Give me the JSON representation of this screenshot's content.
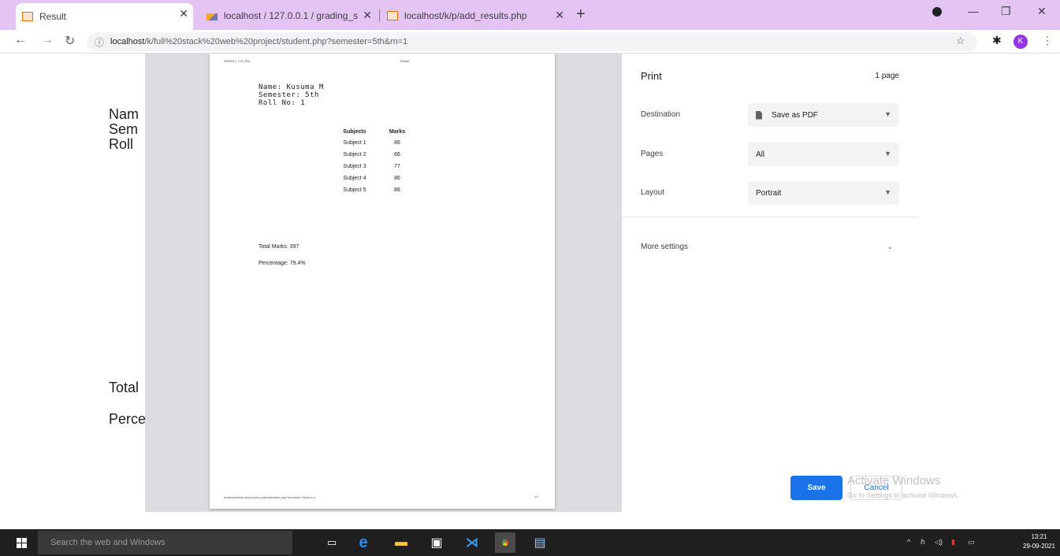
{
  "browser": {
    "tabs": [
      {
        "title": "Result"
      },
      {
        "title": "localhost / 127.0.0.1 / grading_s"
      },
      {
        "title": "localhost/k/p/add_results.php"
      }
    ],
    "address_host": "localhost",
    "address_path": "/k/full%20stack%20web%20project/student.php?semester=5th&rn=1"
  },
  "background_page": {
    "lines": [
      "Nam",
      "Sem",
      "Roll"
    ],
    "total": "Total",
    "percentage": "Perce"
  },
  "print_preview": {
    "header_date": "29/09/21, 1:21 PM",
    "header_title": "Result",
    "name_line": "Name: Kusuma M",
    "semester_line": "Semester: 5th",
    "roll_line": "Roll No: 1",
    "table_headers": [
      "Subjects",
      "Marks"
    ],
    "rows": [
      {
        "subject": "Subject 1",
        "marks": "86"
      },
      {
        "subject": "Subject 2",
        "marks": "66"
      },
      {
        "subject": "Subject 3",
        "marks": "77"
      },
      {
        "subject": "Subject 4",
        "marks": "86"
      },
      {
        "subject": "Subject 5",
        "marks": "86"
      }
    ],
    "total_marks": "Total Marks: 397",
    "percentage": "Percentage: 79.4%",
    "footer_url": "localhost/k/full stack web project/student.php?semester=5th&rn=1",
    "page_number": "1/1"
  },
  "print_panel": {
    "title": "Print",
    "page_count": "1 page",
    "destination_label": "Destination",
    "destination_value": "Save as PDF",
    "pages_label": "Pages",
    "pages_value": "All",
    "layout_label": "Layout",
    "layout_value": "Portrait",
    "more_settings": "More settings",
    "save_button": "Save",
    "cancel_button": "Cancel"
  },
  "watermark": {
    "line1": "Activate Windows",
    "line2": "Go to Settings to activate Windows."
  },
  "taskbar": {
    "search_placeholder": "Search the web and Windows",
    "time": "13:21",
    "date": "29-09-2021"
  }
}
